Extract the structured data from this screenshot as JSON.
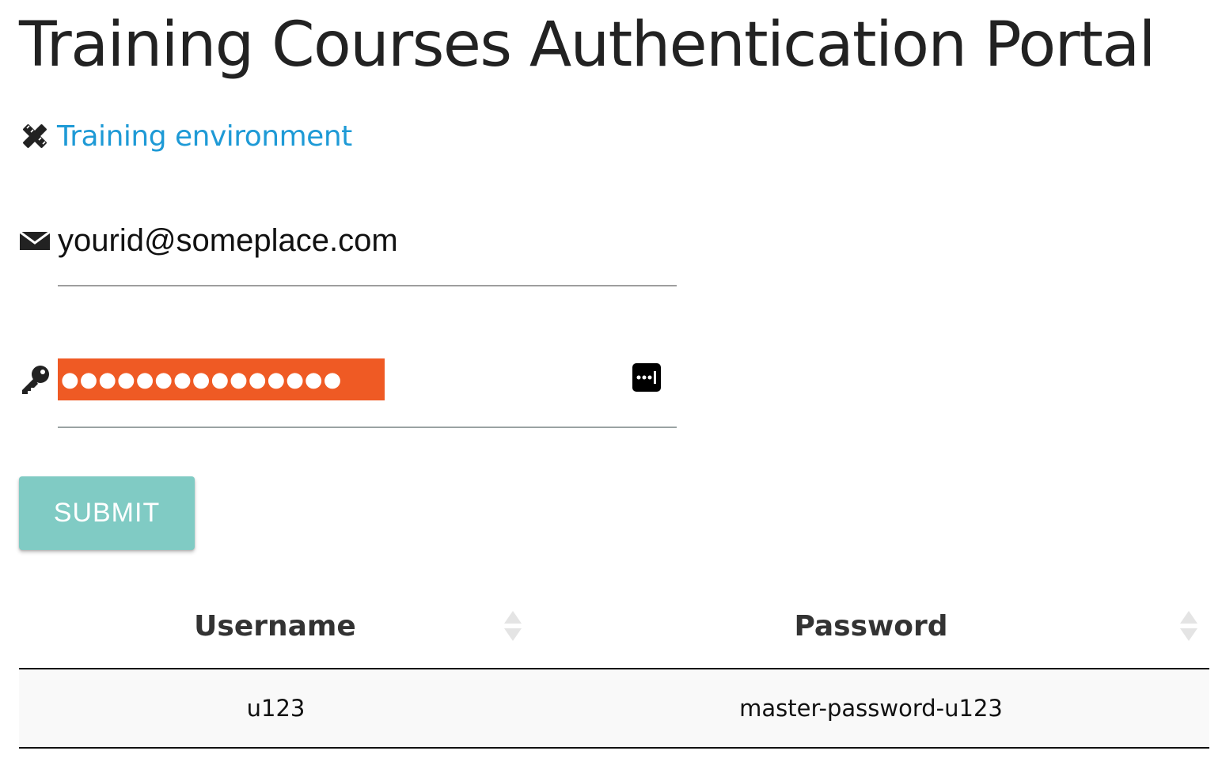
{
  "page": {
    "title": "Training Courses Authentication Portal"
  },
  "environment": {
    "icon": "pencil-ruler-icon",
    "link_text": "Training environment",
    "link_color": "#1e9ad6"
  },
  "form": {
    "email": {
      "icon": "envelope-icon",
      "value": "yourid@someplace.com"
    },
    "password": {
      "icon": "key-icon",
      "masked_value": "●●●●●●●●●●●●●●●",
      "highlight_color": "#ef5a24",
      "manager_icon": "password-manager-icon"
    },
    "submit_label": "SUBMIT",
    "submit_color": "#80cbc4"
  },
  "table": {
    "columns": [
      {
        "label": "Username",
        "sort_icon": "sort-icon"
      },
      {
        "label": "Password",
        "sort_icon": "sort-icon"
      }
    ],
    "rows": [
      {
        "username": "u123",
        "password": "master-password-u123"
      }
    ]
  }
}
